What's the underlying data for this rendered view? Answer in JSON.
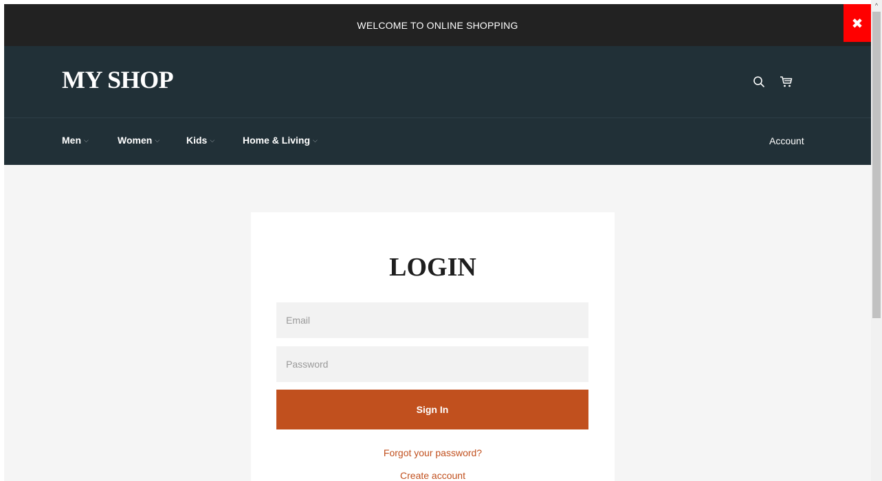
{
  "announcement": {
    "text": "WELCOME TO ONLINE SHOPPING",
    "close_label": "✖"
  },
  "header": {
    "logo": "MY SHOP",
    "icons": [
      "search-icon",
      "cart-icon"
    ]
  },
  "nav": {
    "items": [
      {
        "label": "Men",
        "chevron": "⌵"
      },
      {
        "label": "Women",
        "chevron": "⌵"
      },
      {
        "label": "Kids",
        "chevron": "⌵"
      },
      {
        "label": "Home & Living",
        "chevron": "⌵"
      }
    ],
    "account": "Account"
  },
  "login": {
    "title": "LOGIN",
    "email_placeholder": "Email",
    "password_placeholder": "Password",
    "submit": "Sign In",
    "forgot": "Forgot your password?",
    "create": "Create account"
  },
  "scrollbar": {
    "up_arrow": "^"
  },
  "colors": {
    "topbar": "#222222",
    "header": "#213037",
    "accent": "#c1501e",
    "close": "#ff0000",
    "background": "#f5f5f5"
  }
}
